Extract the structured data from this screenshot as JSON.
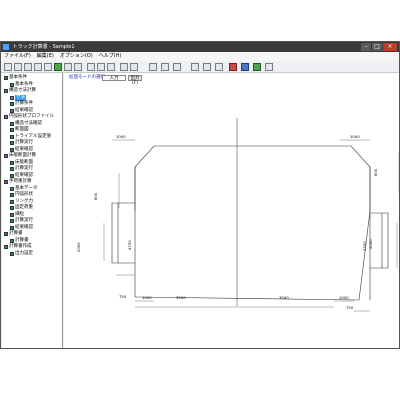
{
  "window": {
    "title": "トラック計算書 - Sample1"
  },
  "menu": {
    "items": [
      "ファイル(F)",
      "編集(E)",
      "オプション(O)",
      "ヘルプ(H)"
    ]
  },
  "sidebar": {
    "items": [
      {
        "label": "基本条件",
        "level": 0,
        "color": "#2e8b57"
      },
      {
        "label": "基本条件",
        "level": 1,
        "color": "#2e8b57"
      },
      {
        "label": "構造寸法計算",
        "level": 0,
        "color": "#2e8b57"
      },
      {
        "label": "寸法",
        "level": 1,
        "color": "#3399ff",
        "selected": true
      },
      {
        "label": "計算条件",
        "level": 1,
        "color": "#2e8b57"
      },
      {
        "label": "結果確認",
        "level": 1,
        "color": "#2e8b57"
      },
      {
        "label": "円弧形状プロファイル",
        "level": 0,
        "color": "#8a4fbf"
      },
      {
        "label": "構造寸法確認",
        "level": 1,
        "color": "#2e8b57"
      },
      {
        "label": "断面図",
        "level": 1,
        "color": "#2e8b57"
      },
      {
        "label": "トライアル設定値",
        "level": 1,
        "color": "#2e8b57"
      },
      {
        "label": "計算実行",
        "level": 1,
        "color": "#2e8b57"
      },
      {
        "label": "結果確認",
        "level": 1,
        "color": "#2e8b57"
      },
      {
        "label": "床版断面計算",
        "level": 0,
        "color": "#8a4fbf"
      },
      {
        "label": "床版断面",
        "level": 1,
        "color": "#2e8b57"
      },
      {
        "label": "計算実行",
        "level": 1,
        "color": "#2e8b57"
      },
      {
        "label": "結果確認",
        "level": 1,
        "color": "#2e8b57"
      },
      {
        "label": "手荷重計算",
        "level": 0,
        "color": "#8a4fbf"
      },
      {
        "label": "基本データ",
        "level": 1,
        "color": "#2e8b57"
      },
      {
        "label": "円弧形状",
        "level": 1,
        "color": "#2e8b57"
      },
      {
        "label": "リング力",
        "level": 1,
        "color": "#2e8b57"
      },
      {
        "label": "固定荷重",
        "level": 1,
        "color": "#2e8b57"
      },
      {
        "label": "細粒",
        "level": 1,
        "color": "#2e8b57"
      },
      {
        "label": "計算実行",
        "level": 1,
        "color": "#2e8b57"
      },
      {
        "label": "結果確認",
        "level": 1,
        "color": "#2e8b57"
      },
      {
        "label": "計算書",
        "level": 0,
        "color": "#2e8b57"
      },
      {
        "label": "計算書",
        "level": 1,
        "color": "#2e8b57"
      },
      {
        "label": "計算書作成",
        "level": 0,
        "color": "#2e8b57"
      },
      {
        "label": "出力設定",
        "level": 1,
        "color": "#2e8b57"
      }
    ]
  },
  "modebar": {
    "label": "処理モードの選択",
    "input_value": "入力",
    "button_label": "出力(F)"
  },
  "drawing": {
    "dims": {
      "top_left": "1000",
      "top_right": "1000",
      "left_slope": "800",
      "right_slope": "800",
      "left_height": "4700",
      "right_height": "4700",
      "left_end": "2000",
      "right_end": "2000",
      "left_small": "750",
      "right_small": "750",
      "bottom_left_seg": "1000",
      "bottom_center_left": "3500",
      "bottom_center_right": "3500",
      "bottom_right_seg": "1000"
    }
  }
}
